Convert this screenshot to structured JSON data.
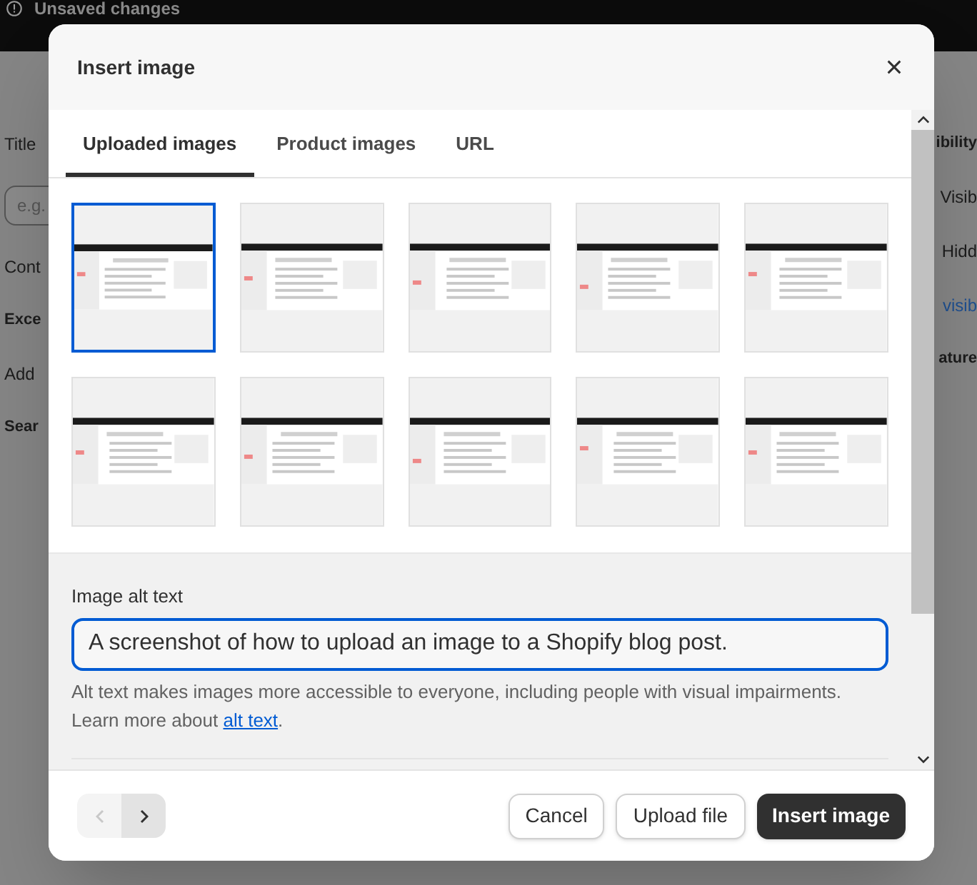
{
  "background_page": {
    "top_bar": {
      "status": "Unsaved changes"
    },
    "left_fragments": [
      {
        "kind": "label",
        "text": "Title"
      },
      {
        "kind": "input",
        "text": "e.g."
      },
      {
        "kind": "label",
        "text": "Cont"
      },
      {
        "kind": "heading",
        "text": "Exce"
      },
      {
        "kind": "label",
        "text": "Add"
      },
      {
        "kind": "heading",
        "text": "Sear"
      }
    ],
    "right_fragments": [
      {
        "kind": "heading",
        "text": "ibility"
      },
      {
        "kind": "label",
        "text": "Visib"
      },
      {
        "kind": "label",
        "text": "Hidd"
      },
      {
        "kind": "link",
        "text": "visib"
      },
      {
        "kind": "heading",
        "text": "ature"
      }
    ]
  },
  "dialog": {
    "title": "Insert image",
    "tabs": [
      {
        "label": "Uploaded images",
        "selected": true
      },
      {
        "label": "Product images",
        "selected": false
      },
      {
        "label": "URL",
        "selected": false
      }
    ],
    "images": [
      {
        "kind": "picture",
        "selected": true
      },
      {
        "kind": "picture",
        "selected": false
      },
      {
        "kind": "picture",
        "selected": false
      },
      {
        "kind": "picture",
        "selected": false
      },
      {
        "kind": "picture",
        "selected": false
      },
      {
        "kind": "picture",
        "selected": false
      },
      {
        "kind": "picture",
        "selected": false
      },
      {
        "kind": "picture",
        "selected": false
      },
      {
        "kind": "picture",
        "selected": false
      },
      {
        "kind": "picture",
        "selected": false
      }
    ],
    "alt_text": {
      "label": "Image alt text",
      "value": "A screenshot of how to upload an image to a Shopify blog post.",
      "help": "Alt text makes images more accessible to everyone, including people with visual impairments. Learn more about",
      "link": "alt text",
      "after_link": "."
    },
    "pagination": {
      "previous": {
        "disabled": true
      },
      "next": {
        "disabled": false
      }
    },
    "buttons": [
      {
        "label": "Cancel",
        "kind": "secondary"
      },
      {
        "label": "Upload file",
        "kind": "secondary"
      },
      {
        "label": "Insert image",
        "kind": "primary"
      }
    ]
  }
}
